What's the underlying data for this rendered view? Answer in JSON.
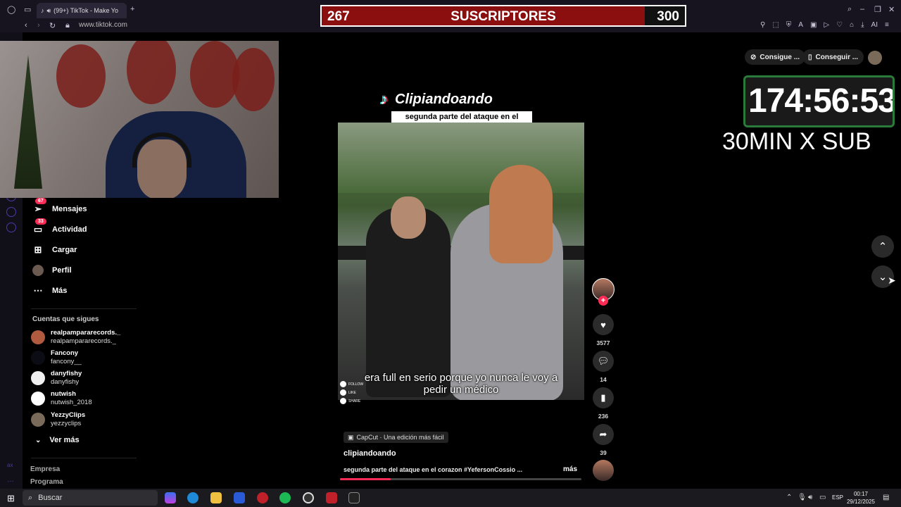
{
  "browser": {
    "tab_title": "(99+) TikTok - Make Yo",
    "url": "www.tiktok.com"
  },
  "overlay": {
    "sub_current": "267",
    "sub_label": "SUSCRIPTORES",
    "sub_goal": "300",
    "sub_progress_fraction": 0.89,
    "timer": "174:56:53",
    "rate": "30MIN X SUB"
  },
  "sidebar": {
    "items": [
      {
        "label": "Mensajes",
        "badge": "67",
        "icon": "paper-plane-icon"
      },
      {
        "label": "Actividad",
        "badge": "33",
        "icon": "chat-bubble-icon"
      },
      {
        "label": "Cargar",
        "badge": "",
        "icon": "plus-square-icon"
      },
      {
        "label": "Perfil",
        "badge": "",
        "icon": "avatar-icon"
      },
      {
        "label": "Más",
        "badge": "",
        "icon": "ellipsis-icon"
      }
    ],
    "following_title": "Cuentas que sigues",
    "following": [
      {
        "name": "realpampararecords._",
        "handle": "realpampararecords._"
      },
      {
        "name": "Fancony",
        "handle": "fancony__"
      },
      {
        "name": "danyfishy",
        "handle": "danyfishy"
      },
      {
        "name": "nutwish",
        "handle": "nutwish_2018"
      },
      {
        "name": "YezzyClips",
        "handle": "yezzyclips"
      }
    ],
    "see_more": "Ver más",
    "footer_links": [
      "Empresa",
      "Programa"
    ]
  },
  "video": {
    "channel_watermark": "Clipiandoando",
    "caption_top": "segunda parte del ataque en el corazon que sufrio  jeferson cossio",
    "subtitle": "era full en serio porque yo nunca le voy a pedir un médico",
    "mini_labels": [
      "FOLLOW",
      "LIKE",
      "SHARE"
    ],
    "capcut_label": "CapCut · Una edición más fácil",
    "author": "clipiandoando",
    "description": "segunda parte del ataque en el corazon #YefersonCossio ...",
    "more_label": "más",
    "progress_fraction": 0.21,
    "likes": "3577",
    "comments": "14",
    "saves": "236",
    "shares": "39"
  },
  "top_right": {
    "pill1": "Consigue ...",
    "pill2": "Conseguir ..."
  },
  "taskbar": {
    "search_placeholder": "Buscar",
    "lang": "ESP",
    "time": "00:17",
    "date": "29/12/2025"
  },
  "colors": {
    "tiktok_red": "#fe2c55",
    "banner_red": "#8b0f0f",
    "opera_purple": "#4a3aa8"
  }
}
